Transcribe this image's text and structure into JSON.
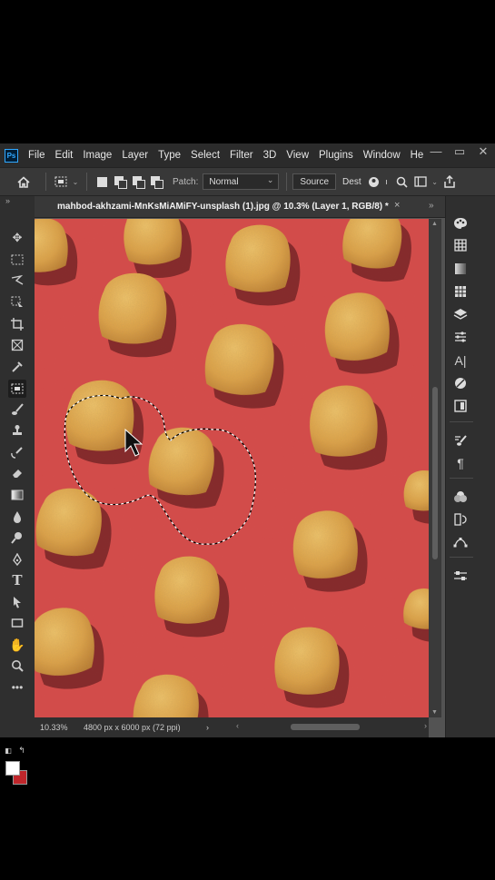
{
  "app": {
    "logo_text": "Ps",
    "menu": [
      "File",
      "Edit",
      "Image",
      "Layer",
      "Type",
      "Select",
      "Filter",
      "3D",
      "View",
      "Plugins",
      "Window",
      "He"
    ],
    "window_controls": [
      "—",
      "▭",
      "✕"
    ]
  },
  "options": {
    "patch_label": "Patch:",
    "patch_mode": "Normal",
    "source_label": "Source",
    "dest_label": "Dest"
  },
  "document": {
    "tab_title": "mahbod-akhzami-MnKsMiAMiFY-unsplash (1).jpg @ 10.3% (Layer 1, RGB/8) *",
    "close_glyph": "×"
  },
  "status": {
    "zoom": "10.33%",
    "doc_size": "4800 px x 6000 px (72 ppi)",
    "arrow": "›"
  },
  "toolbar_icons": [
    "move-icon",
    "marquee-icon",
    "lasso-icon",
    "object-select-icon",
    "crop-icon",
    "frame-icon",
    "eyedropper-icon",
    "patch-icon",
    "brush-icon",
    "stamp-icon",
    "history-brush-icon",
    "eraser-icon",
    "gradient-icon",
    "blur-icon",
    "dodge-icon",
    "pen-icon",
    "type-icon",
    "path-select-icon",
    "rectangle-icon",
    "hand-icon",
    "zoom-icon",
    "more-icon"
  ],
  "panel_icons": [
    "color-icon",
    "swatches-icon",
    "gradients-icon",
    "patterns-icon",
    "layers-icon",
    "adjustments-icon",
    "character-icon",
    "styles-icon",
    "libraries-icon",
    "brush-settings-icon",
    "paragraph-icon",
    "channels-icon",
    "history-icon",
    "paths-icon",
    "properties-icon"
  ],
  "colors": {
    "canvas_bg": "#d24a48",
    "chip": "#e0a94a",
    "foreground": "#ffffff",
    "background": "#c0262b"
  }
}
